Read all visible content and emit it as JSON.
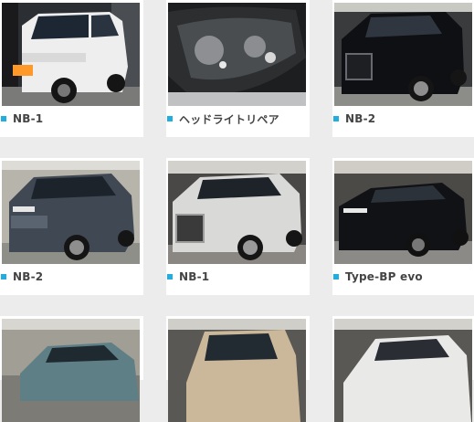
{
  "accent_color": "#20aee0",
  "gallery": {
    "items": [
      {
        "label": "NB-1",
        "photo": "white-kei-van-photo"
      },
      {
        "label": "ヘッドライトリペア",
        "photo": "headlight-closeup-photo"
      },
      {
        "label": "NB-2",
        "photo": "black-minivan-photo"
      },
      {
        "label": "NB-2",
        "photo": "blue-gray-minivan-photo"
      },
      {
        "label": "NB-1",
        "photo": "silver-lexus-minivan-photo"
      },
      {
        "label": "Type-BP evo",
        "photo": "black-crossover-photo"
      },
      {
        "label": "",
        "photo": "teal-crossover-photo"
      },
      {
        "label": "",
        "photo": "beige-kei-car-photo"
      },
      {
        "label": "",
        "photo": "white-suv-photo"
      }
    ]
  }
}
